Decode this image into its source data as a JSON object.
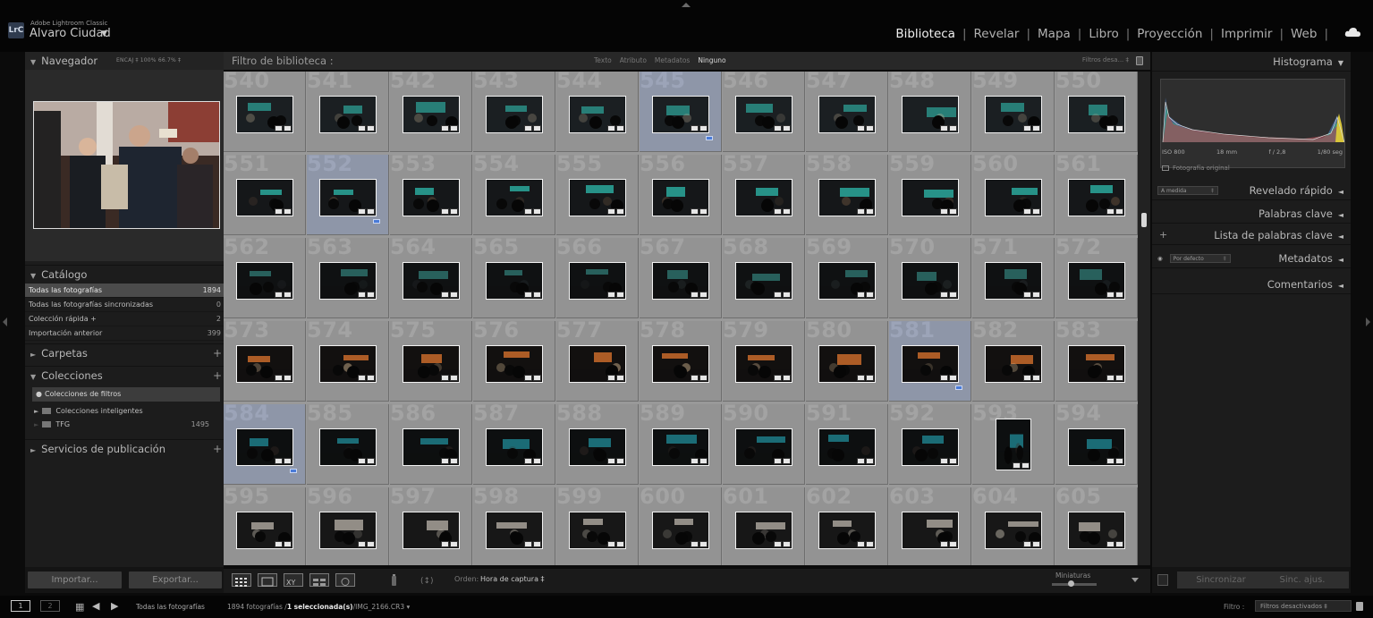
{
  "top": {
    "app_name": "Adobe Lightroom Classic",
    "logo_text": "LrC",
    "user_name": "Alvaro Ciudad",
    "user_caret": "▼",
    "modules": [
      "Biblioteca",
      "Revelar",
      "Mapa",
      "Libro",
      "Proyección",
      "Imprimir",
      "Web"
    ],
    "active_module": "Biblioteca"
  },
  "navigator": {
    "title": "Navegador",
    "zoom_levels": "ENCAJ ‡  100%  66.7% ‡"
  },
  "catalog": {
    "title": "Catálogo",
    "rows": [
      {
        "label": "Todas las fotografías",
        "count": "1894",
        "selected": true
      },
      {
        "label": "Todas las fotografías sincronizadas",
        "count": "0",
        "selected": false
      },
      {
        "label": "Colección rápida  +",
        "count": "2",
        "selected": false
      },
      {
        "label": "Importación anterior",
        "count": "399",
        "selected": false
      }
    ]
  },
  "folders": {
    "title": "Carpetas"
  },
  "collections": {
    "title": "Colecciones",
    "filter_label": "Colecciones de filtros",
    "items": [
      {
        "label": "Colecciones inteligentes",
        "count": ""
      },
      {
        "label": "TFG",
        "count": "1495"
      }
    ]
  },
  "publish": {
    "title": "Servicios de publicación"
  },
  "left_buttons": {
    "import": "Importar...",
    "export": "Exportar..."
  },
  "filter_bar": {
    "title": "Filtro de biblioteca :",
    "tabs": [
      "Texto",
      "Atributo",
      "Metadatos",
      "Ninguno"
    ],
    "active_tab": "Ninguno",
    "preset": "Filtros desa... ‡"
  },
  "grid": {
    "columns": 11,
    "rows": [
      {
        "numbers": [
          "540",
          "541",
          "542",
          "543",
          "544",
          "545",
          "546",
          "547",
          "548",
          "549",
          "550"
        ],
        "selected": [
          5
        ]
      },
      {
        "numbers": [
          "551",
          "552",
          "553",
          "554",
          "555",
          "556",
          "557",
          "558",
          "559",
          "560",
          "561"
        ],
        "selected": [
          1
        ]
      },
      {
        "numbers": [
          "562",
          "563",
          "564",
          "565",
          "566",
          "567",
          "568",
          "569",
          "570",
          "571",
          "572"
        ],
        "selected": []
      },
      {
        "numbers": [
          "573",
          "574",
          "575",
          "576",
          "577",
          "578",
          "579",
          "580",
          "581",
          "582",
          "583"
        ],
        "selected": [
          8
        ]
      },
      {
        "numbers": [
          "584",
          "585",
          "586",
          "587",
          "588",
          "589",
          "590",
          "591",
          "592",
          "593",
          "594"
        ],
        "selected": [
          0
        ]
      },
      {
        "numbers": [
          "595",
          "596",
          "597",
          "598",
          "599",
          "600",
          "601",
          "602",
          "603",
          "604",
          "605"
        ],
        "selected": []
      }
    ]
  },
  "toolbar": {
    "sort_label": "Orden:",
    "sort_value": "Hora de captura ‡",
    "thumb_label": "Miniaturas"
  },
  "right_panel": {
    "histogram_title": "Histograma",
    "histo_info": [
      "ISO 800",
      "18 mm",
      "f / 2,8",
      "1/80 seg"
    ],
    "original_photo": "Fotografía original",
    "quick_develop": "Revelado rápido",
    "quick_develop_preset": "A medida",
    "keywords": "Palabras clave",
    "keyword_list": "Lista de palabras clave",
    "metadata": "Metadatos",
    "metadata_preset": "Por defecto",
    "comments": "Comentarios",
    "sync_button": "Sincronizar",
    "sync_settings_button": "Sinc. ajus."
  },
  "bottom_bar": {
    "view1": "1",
    "view2": "2",
    "source": "Todas las fotografías",
    "info_prefix": "1894 fotografías /",
    "info_selected": "1 seleccionada(s)",
    "info_suffix": "/IMG_2166.CR3 ▾",
    "filter_label": "Filtro :",
    "filter_value": "Filtros desactivados ‡"
  },
  "colors": {
    "panel_bg": "#1c1c1c",
    "grid_bg": "#939393",
    "selected_cell": "#8e96a8",
    "pick_flag": "#4a7bd8"
  }
}
